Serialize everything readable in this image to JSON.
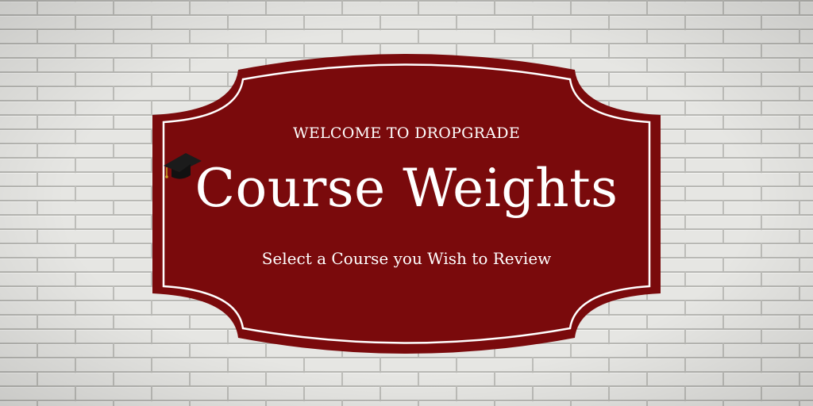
{
  "sign": {
    "welcome": "WELCOME TO DROPGRADE",
    "title": "Course Weights",
    "subtitle": "Select a Course you Wish to Review"
  },
  "colors": {
    "sign_fill": "#7a0a0c",
    "sign_border": "#ffffff",
    "wall": "#e6e6e3",
    "mortar": "#b9b9b5",
    "cap": "#1a1a1a"
  },
  "icons": {
    "cap": "graduation-cap-icon"
  }
}
